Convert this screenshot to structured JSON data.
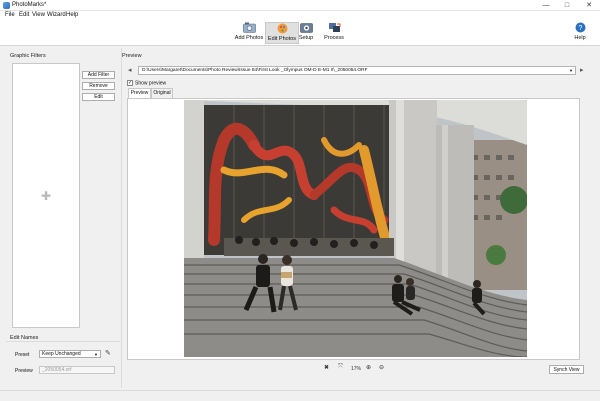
{
  "window": {
    "title": "PhotoMarks*",
    "minimize": "—",
    "maximize": "□",
    "close": "✕"
  },
  "menu": [
    "File",
    "Edit",
    "View",
    "Wizard",
    "Help"
  ],
  "toolbar": {
    "add_photos": "Add Photos",
    "edit_photos": "Edit Photos",
    "setup": "Setup",
    "process": "Process",
    "help": "Help"
  },
  "graphic_filters": {
    "title": "Graphic Filters",
    "add_filter": "Add Filter",
    "remove": "Remove",
    "edit": "Edit"
  },
  "edit_names": {
    "title": "Edit Names",
    "preset_label": "Preset",
    "preset_value": "Keep Unchanged",
    "preview_label": "Preview",
    "preview_value": "_2050054.orf"
  },
  "preview": {
    "title": "Preview",
    "path": "D:\\Users\\Margaret\\Documents\\Photo Review\\Issue 84\\First Look _Olympus OM-D E-M1 II\\_2050054.ORF",
    "show_preview": "Show preview",
    "tabs": [
      "Preview",
      "Original"
    ],
    "active_tab": "Preview",
    "zoom": "17%",
    "sync_view": "Synch View"
  },
  "colors": {
    "accent": "#2c6fc0",
    "tab_active": "#ffffff",
    "panel": "#f0f0f0"
  }
}
